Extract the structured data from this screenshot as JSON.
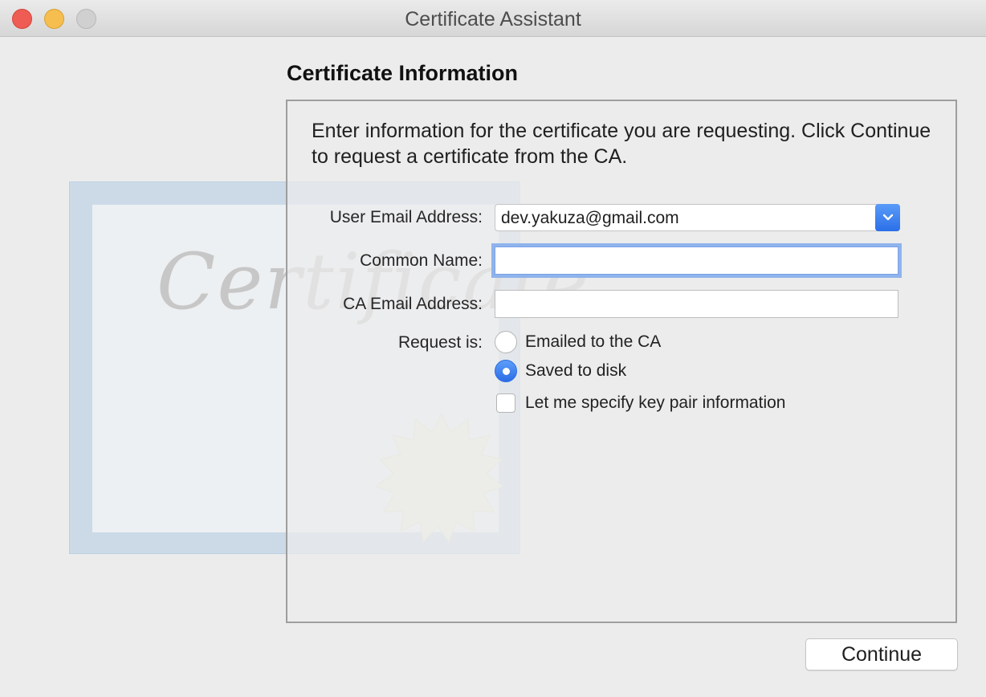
{
  "window": {
    "title": "Certificate Assistant"
  },
  "page": {
    "heading": "Certificate Information",
    "intro": "Enter information for the certificate you are requesting. Click Continue to request a certificate from the CA."
  },
  "form": {
    "user_email_label": "User Email Address:",
    "user_email_value": "dev.yakuza@gmail.com",
    "common_name_label": "Common Name:",
    "common_name_value": "",
    "ca_email_label": "CA Email Address:",
    "ca_email_value": "",
    "request_is_label": "Request is:",
    "request_options": [
      {
        "label": "Emailed to the CA",
        "selected": false
      },
      {
        "label": "Saved to disk",
        "selected": true
      }
    ],
    "key_pair_label": "Let me specify key pair information",
    "key_pair_checked": false
  },
  "buttons": {
    "continue_label": "Continue"
  },
  "artwork": {
    "script_text": "Certificate"
  },
  "colors": {
    "accent": "#2c6de6",
    "focus_ring": "#8fb3ec",
    "close": "#ee5c53",
    "minimize": "#f5be4f"
  }
}
